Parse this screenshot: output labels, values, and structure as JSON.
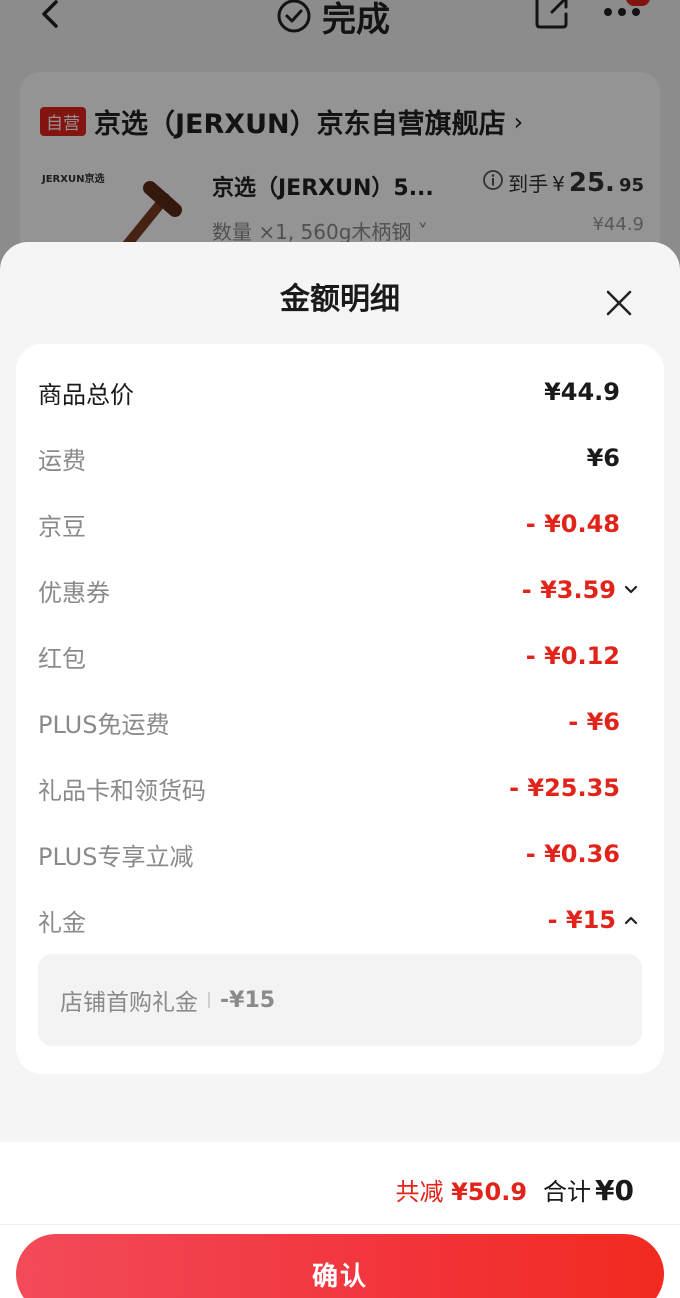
{
  "header": {
    "title": "完成",
    "back_icon": "chevron-left-icon",
    "done_icon": "check-circle-icon",
    "share_icon": "share-icon",
    "more_icon": "more-dots-icon"
  },
  "shop": {
    "tag": "自营",
    "name": "京选（JERXUN）京东自营旗舰店",
    "chevron": "›"
  },
  "product": {
    "brand_mark": "JERXUN京选",
    "title": "京选（JERXUN）5...",
    "spec": "数量 ×1, 560g木柄钢  ˅",
    "arrival_label": "到手",
    "arrival_symbol": "¥",
    "arrival_int": "25.",
    "arrival_dec": "95",
    "orig_price": "¥44.9"
  },
  "sheet": {
    "title": "金额明细",
    "rows": [
      {
        "label": "商品总价",
        "value": "¥44.9"
      },
      {
        "label": "运费",
        "value": "¥6"
      },
      {
        "label": "京豆",
        "value": "- ¥0.48"
      },
      {
        "label": "优惠券",
        "value": "- ¥3.59"
      },
      {
        "label": "红包",
        "value": "- ¥0.12"
      },
      {
        "label": "PLUS免运费",
        "value": "- ¥6"
      },
      {
        "label": "礼品卡和领货码",
        "value": "- ¥25.35"
      },
      {
        "label": "PLUS专享立减",
        "value": "- ¥0.36"
      },
      {
        "label": "礼金",
        "value": "- ¥15"
      }
    ],
    "sub_item": {
      "label": "店铺首购礼金",
      "value": "-¥15"
    }
  },
  "footer": {
    "saved_label": "共减",
    "saved_value": "¥50.9",
    "total_label": "合计",
    "total_value": "¥0",
    "confirm_label": "确认"
  },
  "colors": {
    "accent_red": "#e2231a",
    "button_gradient_start": "#f34a5a",
    "button_gradient_end": "#f22a20"
  }
}
